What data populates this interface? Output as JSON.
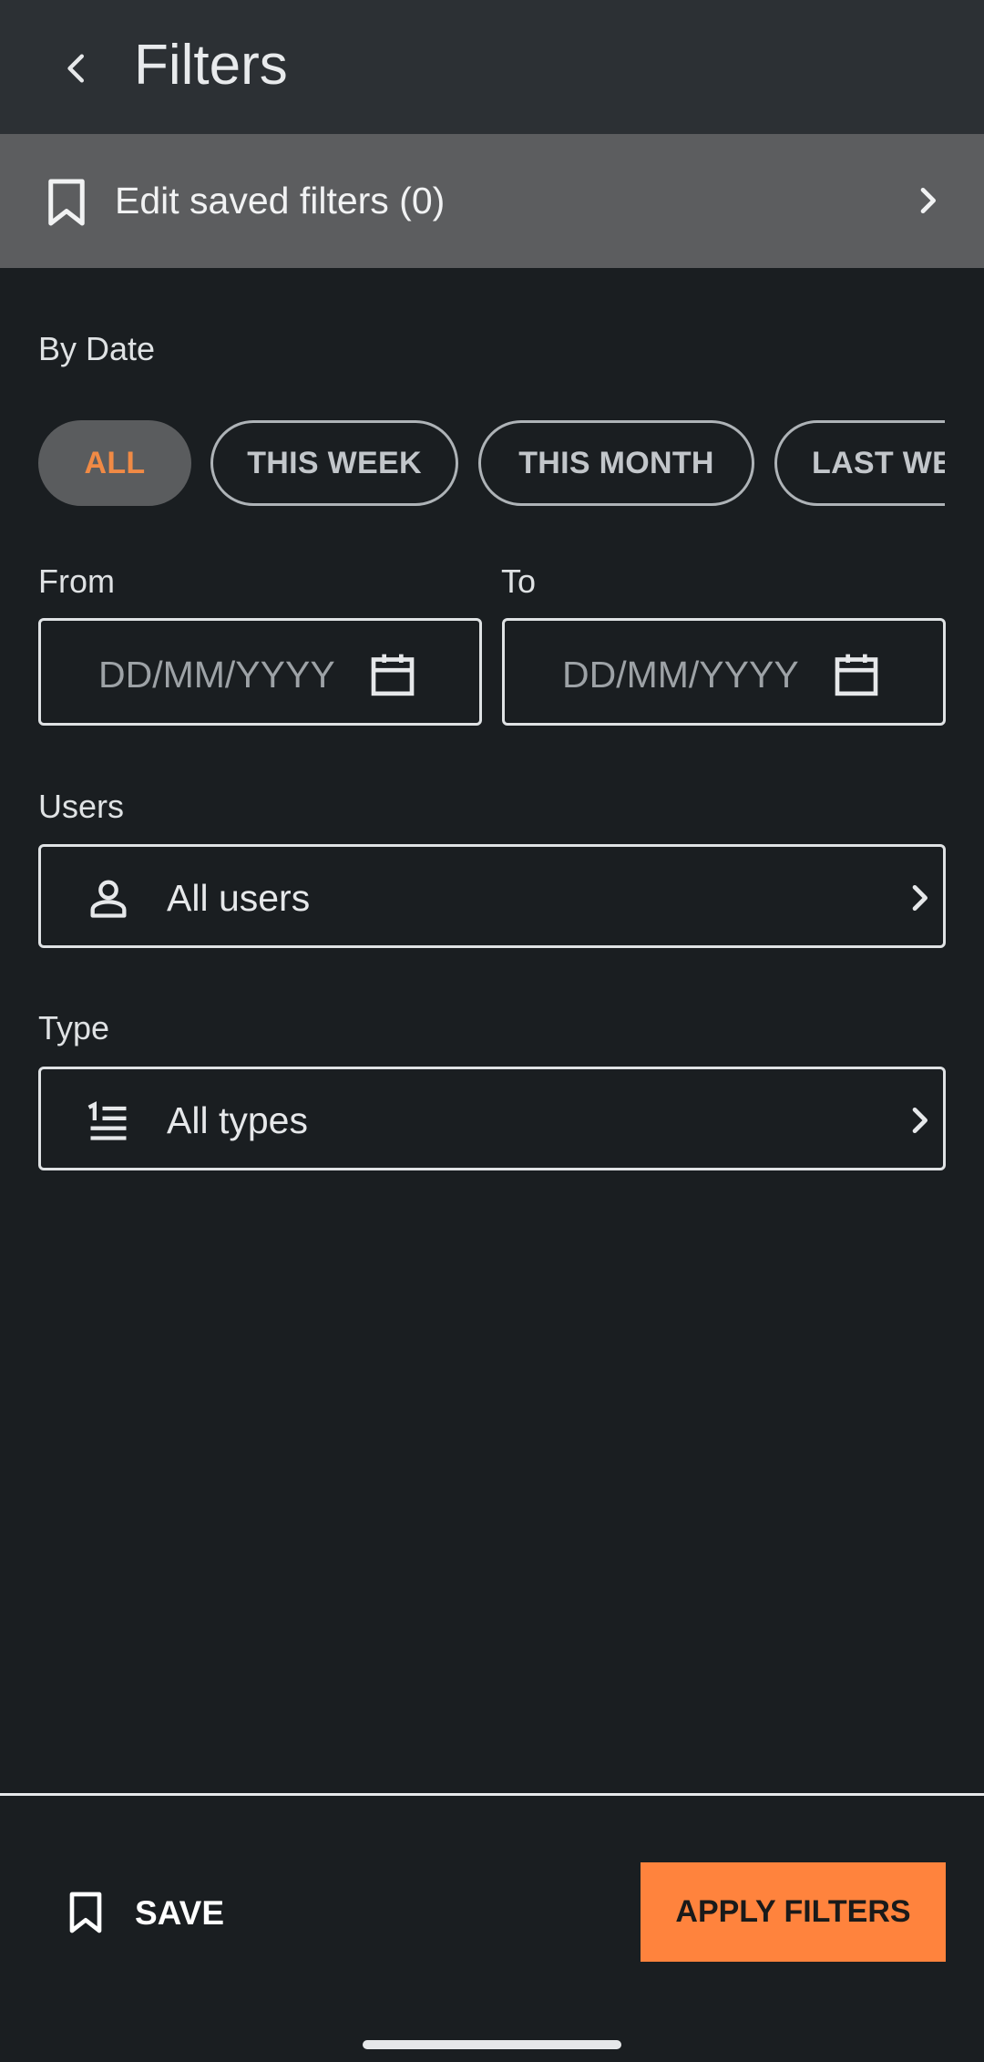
{
  "header": {
    "title": "Filters"
  },
  "saved_filters": {
    "label": "Edit saved filters (0)"
  },
  "by_date": {
    "label": "By Date",
    "chips": [
      {
        "label": "ALL"
      },
      {
        "label": "THIS WEEK"
      },
      {
        "label": "THIS MONTH"
      },
      {
        "label": "LAST WEEK"
      }
    ],
    "selected": "ALL"
  },
  "date_range": {
    "from_label": "From",
    "to_label": "To",
    "from_placeholder": "DD/MM/YYYY",
    "to_placeholder": "DD/MM/YYYY"
  },
  "users": {
    "label": "Users",
    "value": "All users"
  },
  "type": {
    "label": "Type",
    "value": "All types"
  },
  "footer": {
    "save_label": "SAVE",
    "apply_label": "APPLY FILTERS"
  },
  "colors": {
    "accent": "#ff833d",
    "background": "#1a1e21",
    "header": "#2c3034",
    "saved_row": "#5c5d5f"
  },
  "icons": [
    "back-arrow-icon",
    "bookmark-icon",
    "chevron-right-icon",
    "calendar-icon",
    "person-icon",
    "list-icon"
  ]
}
